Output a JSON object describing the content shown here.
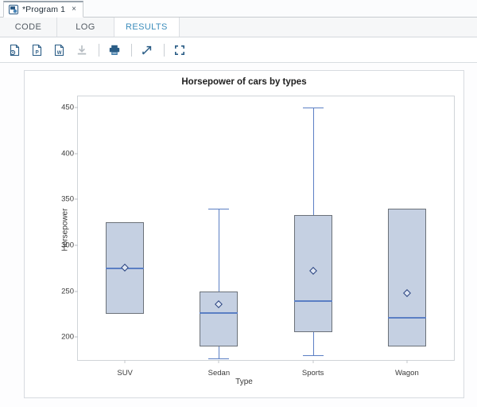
{
  "window": {
    "program_tab": {
      "title": "*Program 1",
      "close_label": "×",
      "icon": "sas-program-icon"
    }
  },
  "subtabs": [
    {
      "label": "CODE",
      "active": false
    },
    {
      "label": "LOG",
      "active": false
    },
    {
      "label": "RESULTS",
      "active": true
    }
  ],
  "toolbar": {
    "buttons": [
      {
        "name": "export-html-icon",
        "title": "Download results as HTML",
        "enabled": true
      },
      {
        "name": "export-pdf-icon",
        "title": "Download results as PDF",
        "enabled": true
      },
      {
        "name": "export-word-icon",
        "title": "Download results as Word",
        "enabled": true
      },
      {
        "name": "download-icon",
        "title": "Download",
        "enabled": false
      },
      {
        "name": "print-icon",
        "title": "Print",
        "enabled": true
      },
      {
        "name": "open-in-new-window-icon",
        "title": "Open in new window",
        "enabled": true
      },
      {
        "name": "maximize-view-icon",
        "title": "Maximize view",
        "enabled": true
      }
    ]
  },
  "chart_data": {
    "type": "box",
    "title": "Horsepower of cars by types",
    "xlabel": "Type",
    "ylabel": "Horsepower",
    "categories": [
      "SUV",
      "Sedan",
      "Sports",
      "Wagon"
    ],
    "yticks": [
      200,
      250,
      300,
      350,
      400,
      450
    ],
    "ylim": [
      175,
      462
    ],
    "grid": false,
    "legend": null,
    "colors": {
      "box_fill": "#c5d0e2",
      "box_border": "#6b7179",
      "median_line": "#5b7fc4",
      "whisker": "#5b7fc4",
      "mean_marker": "#26407e"
    },
    "boxes": [
      {
        "category": "SUV",
        "whisker_low": null,
        "q1": 225,
        "median": 275,
        "q3": 325,
        "whisker_high": null,
        "mean": 276
      },
      {
        "category": "Sedan",
        "whisker_low": 177,
        "q1": 190,
        "median": 226,
        "q3": 250,
        "whisker_high": 340,
        "mean": 236
      },
      {
        "category": "Sports",
        "whisker_low": 180,
        "q1": 205,
        "median": 239,
        "q3": 333,
        "whisker_high": 450,
        "mean": 272
      },
      {
        "category": "Wagon",
        "whisker_low": null,
        "q1": 190,
        "median": 221,
        "q3": 340,
        "whisker_high": null,
        "mean": 248
      }
    ]
  }
}
